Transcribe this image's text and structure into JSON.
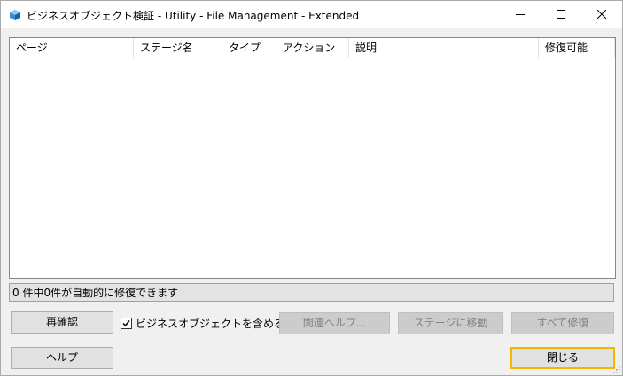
{
  "window": {
    "title": "ビジネスオブジェクト検証 - Utility - File Management - Extended",
    "icon": "blueprism-object-icon",
    "controls": [
      "minimize-icon",
      "maximize-icon",
      "close-icon"
    ]
  },
  "table": {
    "columns": [
      "ページ",
      "ステージ名",
      "タイプ",
      "アクション",
      "説明",
      "修復可能"
    ],
    "rows": []
  },
  "status": "0 件中0件が自動的に修復できます",
  "buttons": {
    "recheck": "再確認",
    "include_label": "ビジネスオブジェクトを含める",
    "include_checked": true,
    "related_help": "関連ヘルプ...",
    "goto_stage": "ステージに移動",
    "fix_all": "すべて修復",
    "help": "ヘルプ",
    "close": "閉じる"
  },
  "colors": {
    "default_button_border": "#f5b500",
    "disabled_text": "#838383"
  }
}
